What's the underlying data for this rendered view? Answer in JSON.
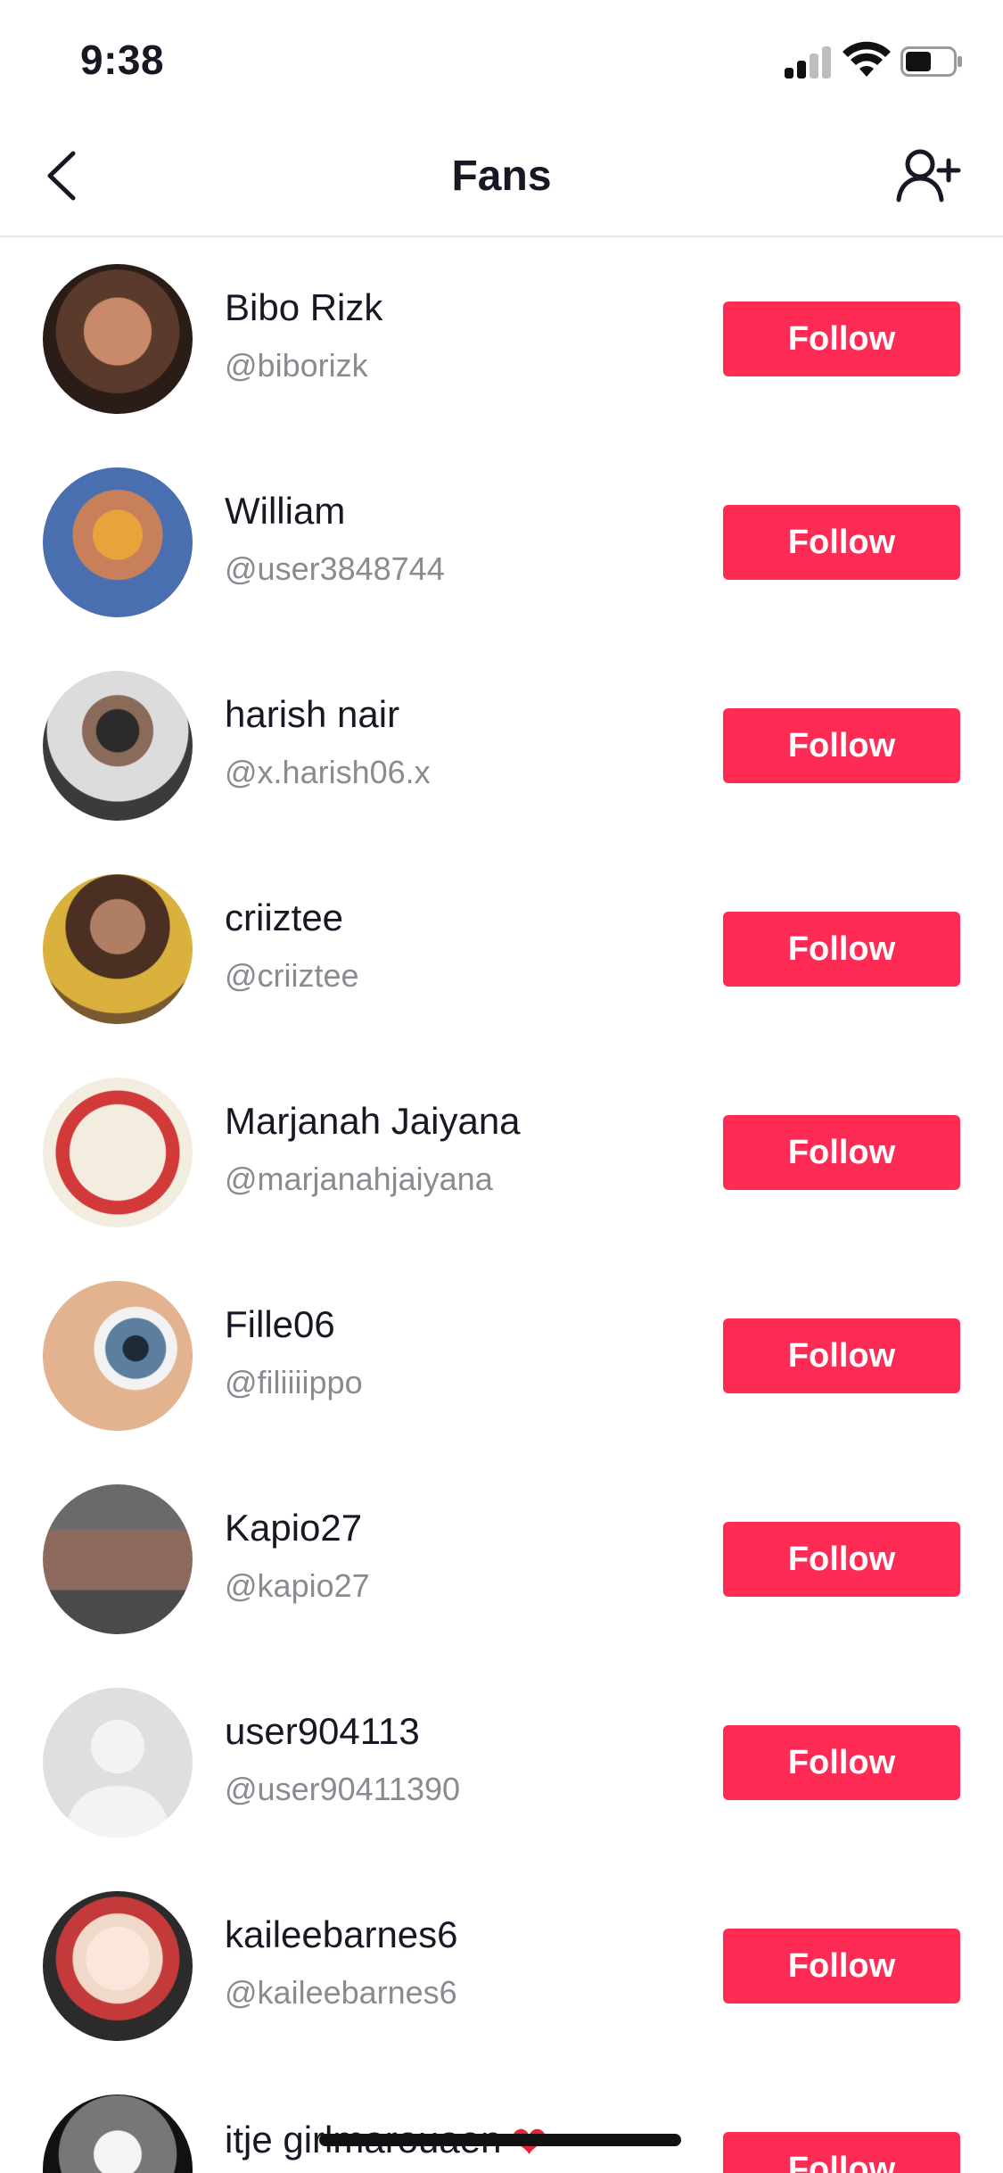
{
  "status_bar": {
    "time": "9:38"
  },
  "nav": {
    "title": "Fans",
    "back_icon": "chevron-left-icon",
    "add_icon": "add-user-icon"
  },
  "colors": {
    "follow_button": "#fe2c55",
    "handle_text": "#8a8b91",
    "divider": "#e6e6e8"
  },
  "fans": [
    {
      "name": "Bibo Rizk",
      "handle": "@biborizk",
      "follow_label": "Follow"
    },
    {
      "name": "William",
      "handle": "@user3848744",
      "follow_label": "Follow"
    },
    {
      "name": "harish nair",
      "handle": "@x.harish06.x",
      "follow_label": "Follow"
    },
    {
      "name": "criiztee",
      "handle": "@criiztee",
      "follow_label": "Follow"
    },
    {
      "name": "Marjanah Jaiyana",
      "handle": "@marjanahjaiyana",
      "follow_label": "Follow"
    },
    {
      "name": "Fille06",
      "handle": "@filiiiippo",
      "follow_label": "Follow"
    },
    {
      "name": "Kapio27",
      "handle": "@kapio27",
      "follow_label": "Follow"
    },
    {
      "name": "user904113",
      "handle": "@user90411390",
      "follow_label": "Follow"
    },
    {
      "name": "kaileebarnes6",
      "handle": "@kaileebarnes6",
      "follow_label": "Follow"
    },
    {
      "name": "itje girlmarouaen",
      "handle": "",
      "follow_label": "Follow"
    }
  ]
}
